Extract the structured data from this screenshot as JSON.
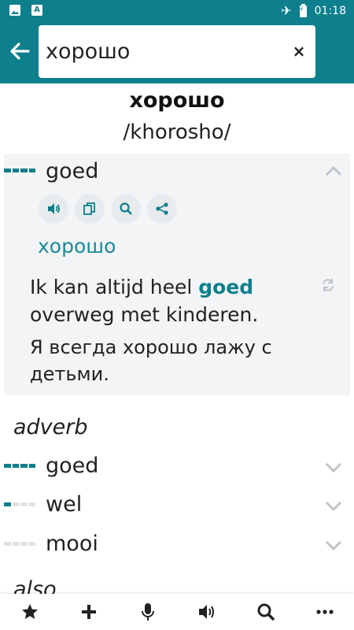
{
  "status_bar": {
    "time": "01:18",
    "left_icons": [
      "image-icon",
      "a-icon"
    ],
    "right_icons": [
      "airplane-icon",
      "battery-charging-icon"
    ]
  },
  "app_bar": {
    "back_icon": "arrow-left-icon",
    "search": {
      "value": "хорошо"
    },
    "clear_icon": "close-icon"
  },
  "entry": {
    "headword": "хорошо",
    "transcription": "/khorosho/"
  },
  "expanded_translation": {
    "word": "goed",
    "frequency": 4,
    "actions": [
      "speaker-icon",
      "copy-icon",
      "search-icon",
      "share-icon"
    ],
    "transliteration": "хорошо",
    "example_nl_before": "Ik kan altijd heel ",
    "example_nl_highlight": "goed",
    "example_nl_after": " overweg met kinderen.",
    "example_ru": "Я всегда хорошо лажу с детьми."
  },
  "sections": [
    {
      "pos": "adverb",
      "items": [
        {
          "word": "goed",
          "frequency": 4
        },
        {
          "word": "wel",
          "frequency": 1
        },
        {
          "word": "mooi",
          "frequency": 0
        }
      ]
    }
  ],
  "next_section_label": "also",
  "bottom_bar": [
    "star-icon",
    "plus-icon",
    "microphone-icon",
    "speaker-icon",
    "search-icon",
    "more-icon"
  ],
  "colors": {
    "accent": "#0e7f8c",
    "card_bg": "#f3f4f5",
    "freq_off": "#dfe3e6"
  }
}
